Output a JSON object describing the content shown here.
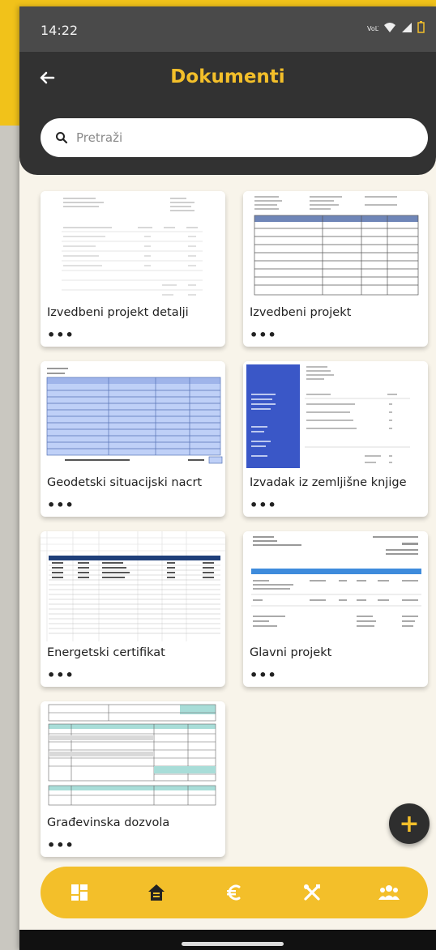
{
  "status": {
    "time": "14:22",
    "icons": [
      "wifi-calling-icon",
      "wifi-icon",
      "signal-icon",
      "battery-icon"
    ]
  },
  "header": {
    "title": "Dokumenti",
    "back_icon": "arrow-left-icon"
  },
  "search": {
    "placeholder": "Pretraži",
    "value": ""
  },
  "documents": [
    {
      "title": "Izvedbeni projekt detalji"
    },
    {
      "title": "Izvedbeni projekt"
    },
    {
      "title": "Geodetski situacijski nacrt"
    },
    {
      "title": "Izvadak iz zemljišne knjige"
    },
    {
      "title": "Energetski certifikat"
    },
    {
      "title": "Glavni projekt"
    },
    {
      "title": "Građevinska dozvola"
    }
  ],
  "more_label": "•••",
  "fab": {
    "label": "+"
  },
  "nav": [
    "dashboard-icon",
    "home-icon",
    "euro-icon",
    "tools-icon",
    "team-icon"
  ],
  "colors": {
    "accent": "#f3bf2a",
    "header_bg": "#323232",
    "page_bg": "#f8f4ea"
  }
}
